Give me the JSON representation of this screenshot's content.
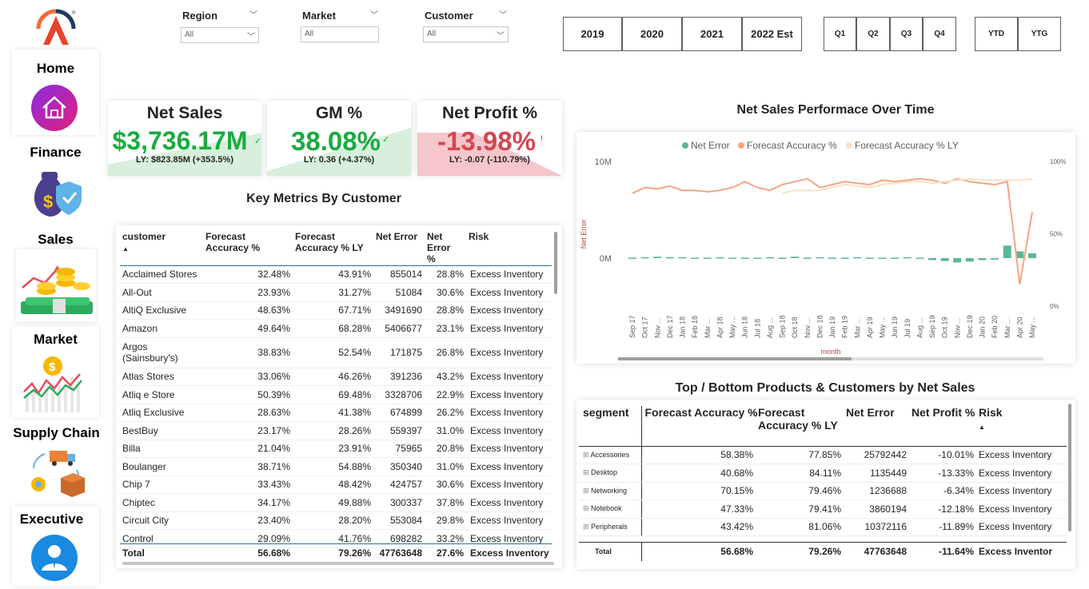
{
  "sidebar": {
    "items": [
      {
        "label": "Home",
        "icon": "home-icon"
      },
      {
        "label": "Finance",
        "icon": "money-bag-icon"
      },
      {
        "label": "Sales",
        "icon": "sales-coins-icon"
      },
      {
        "label": "Market",
        "icon": "market-chart-icon"
      },
      {
        "label": "Supply Chain",
        "icon": "supply-chain-icon"
      },
      {
        "label": "Executive",
        "icon": "executive-icon"
      }
    ]
  },
  "filters": {
    "region": {
      "label": "Region",
      "value": "All"
    },
    "market": {
      "label": "Market",
      "value": "All"
    },
    "customer": {
      "label": "Customer",
      "value": "All"
    }
  },
  "years": [
    "2019",
    "2020",
    "2021",
    "2022 Est"
  ],
  "quarters": [
    "Q1",
    "Q2",
    "Q3",
    "Q4"
  ],
  "periods": [
    "YTD",
    "YTG"
  ],
  "kpis": [
    {
      "title": "Net Sales",
      "value": "$3,736.17M",
      "sub": "LY: $823.85M (+353.5%)",
      "status": "good",
      "indicator": "✓",
      "color": "#1aab40"
    },
    {
      "title": "GM %",
      "value": "38.08%",
      "sub": "LY: 0.36 (+4.37%)",
      "status": "good",
      "indicator": "✓",
      "color": "#1aab40"
    },
    {
      "title": "Net Profit %",
      "value": "-13.98%",
      "sub": "LY: -0.07 (-110.79%)",
      "status": "bad",
      "indicator": "!",
      "color": "#d64550"
    }
  ],
  "customer_table": {
    "title": "Key Metrics By Customer",
    "columns": [
      "customer",
      "Forecast Accuracy %",
      "Forecast Accuracy % LY",
      "Net Error",
      "Net Error %",
      "Risk"
    ],
    "rows": [
      [
        "Acclaimed Stores",
        "32.48%",
        "43.91%",
        "855014",
        "28.8%",
        "Excess Inventory"
      ],
      [
        "All-Out",
        "23.93%",
        "31.27%",
        "51084",
        "30.6%",
        "Excess Inventory"
      ],
      [
        "AltiQ Exclusive",
        "48.63%",
        "67.71%",
        "3491690",
        "28.8%",
        "Excess Inventory"
      ],
      [
        "Amazon",
        "49.64%",
        "68.28%",
        "5406677",
        "23.1%",
        "Excess Inventory"
      ],
      [
        "Argos (Sainsbury's)",
        "38.83%",
        "52.54%",
        "171875",
        "26.8%",
        "Excess Inventory"
      ],
      [
        "Atlas Stores",
        "33.06%",
        "46.26%",
        "391236",
        "43.2%",
        "Excess Inventory"
      ],
      [
        "Atliq e Store",
        "50.39%",
        "69.48%",
        "3328706",
        "22.9%",
        "Excess Inventory"
      ],
      [
        "Atliq Exclusive",
        "28.63%",
        "41.38%",
        "674899",
        "26.2%",
        "Excess Inventory"
      ],
      [
        "BestBuy",
        "23.17%",
        "28.26%",
        "559397",
        "31.0%",
        "Excess Inventory"
      ],
      [
        "Billa",
        "21.04%",
        "23.91%",
        "75965",
        "20.8%",
        "Excess Inventory"
      ],
      [
        "Boulanger",
        "38.71%",
        "54.88%",
        "350340",
        "31.0%",
        "Excess Inventory"
      ],
      [
        "Chip 7",
        "33.43%",
        "48.42%",
        "424757",
        "30.6%",
        "Excess Inventory"
      ],
      [
        "Chiptec",
        "34.17%",
        "49.88%",
        "300337",
        "37.8%",
        "Excess Inventory"
      ],
      [
        "Circuit City",
        "23.40%",
        "28.20%",
        "553084",
        "29.8%",
        "Excess Inventory"
      ],
      [
        "Control",
        "29.09%",
        "41.76%",
        "698282",
        "33.2%",
        "Excess Inventory"
      ]
    ],
    "total": [
      "Total",
      "56.68%",
      "79.26%",
      "47763648",
      "27.6%",
      "Excess Inventory"
    ]
  },
  "segment_table": {
    "title": "Top / Bottom Products & Customers by Net Sales",
    "columns": [
      "segment",
      "Forecast Accuracy %",
      "Forecast Accuracy % LY",
      "Net Error",
      "Net Profit %",
      "Risk"
    ],
    "rows": [
      [
        "Accessories",
        "58.38%",
        "77.85%",
        "25792442",
        "-10.01%",
        "Excess Inventory"
      ],
      [
        "Desktop",
        "40.68%",
        "84.11%",
        "1135449",
        "-13.33%",
        "Excess Inventory"
      ],
      [
        "Networking",
        "70.15%",
        "79.46%",
        "1236688",
        "-6.34%",
        "Excess Inventory"
      ],
      [
        "Notebook",
        "47.33%",
        "79.41%",
        "3860194",
        "-12.18%",
        "Excess Inventory"
      ],
      [
        "Peripherals",
        "43.42%",
        "81.06%",
        "10372116",
        "-11.89%",
        "Excess Inventory"
      ]
    ],
    "total": [
      "Total",
      "56.68%",
      "79.26%",
      "47763648",
      "-11.64%",
      "Excess Inventor"
    ]
  },
  "chart_title": "Net Sales Performace Over Time",
  "chart_data": {
    "type": "line",
    "title": "Net Sales Performace Over Time",
    "xlabel": "month",
    "ylabel": "Net Error",
    "y_left_ticks": [
      "10M",
      "0M"
    ],
    "y_right_ticks": [
      "100%",
      "50%",
      "0%"
    ],
    "legend": [
      "Net Error",
      "Forecast Accuracy %",
      "Forecast Accuracy % LY"
    ],
    "legend_position": "top",
    "colors": {
      "Net Error": "#5ab895",
      "Forecast Accuracy %": "#f4a582",
      "Forecast Accuracy % LY": "#fde0c5"
    },
    "x": [
      "Sep 17",
      "Oct 17",
      "Nov ...",
      "Dec 17",
      "Jan 18",
      "Feb 18",
      "Mar ...",
      "Apr 18",
      "May ...",
      "Jun 18",
      "Jul 18",
      "Aug ...",
      "Sep 18",
      "Oct 18",
      "Nov ...",
      "Dec 18",
      "Jan 19",
      "Feb 19",
      "Mar ...",
      "Apr 19",
      "May ...",
      "Jun 19",
      "Jul 19",
      "Aug ...",
      "Sep 19",
      "Oct 19",
      "Nov ...",
      "Dec 19",
      "Jan 20",
      "Feb 20",
      "Mar ...",
      "Apr 20",
      "May ..."
    ],
    "series": [
      {
        "name": "Forecast Accuracy %",
        "axis": "right",
        "values": [
          78,
          82,
          81,
          83,
          80,
          80,
          79,
          80,
          82,
          86,
          82,
          80,
          84,
          86,
          88,
          82,
          84,
          86,
          85,
          84,
          87,
          86,
          87,
          88,
          87,
          85,
          88,
          86,
          85,
          84,
          86,
          15,
          65
        ]
      },
      {
        "name": "Forecast Accuracy % LY",
        "axis": "right",
        "values": [
          null,
          null,
          null,
          null,
          null,
          null,
          null,
          null,
          null,
          null,
          null,
          null,
          78,
          80,
          80,
          80,
          82,
          84,
          83,
          82,
          84,
          85,
          86,
          86,
          85,
          86,
          87,
          88,
          87,
          87,
          87,
          87,
          88
        ]
      },
      {
        "name": "Net Error",
        "axis": "left",
        "values": [
          0.05,
          0.1,
          0.15,
          0.1,
          0.1,
          0.05,
          0.05,
          0.1,
          0.05,
          0.05,
          0.05,
          0.1,
          0.05,
          0.15,
          0.05,
          0.1,
          0.05,
          0.05,
          0.1,
          0.05,
          0.05,
          0.05,
          0.1,
          0.05,
          -0.2,
          -0.3,
          -0.45,
          -0.35,
          -0.2,
          -0.15,
          1.3,
          0.7,
          0.5
        ]
      }
    ],
    "y_left_range": [
      -5,
      12
    ],
    "y_right_range": [
      0,
      100
    ]
  }
}
